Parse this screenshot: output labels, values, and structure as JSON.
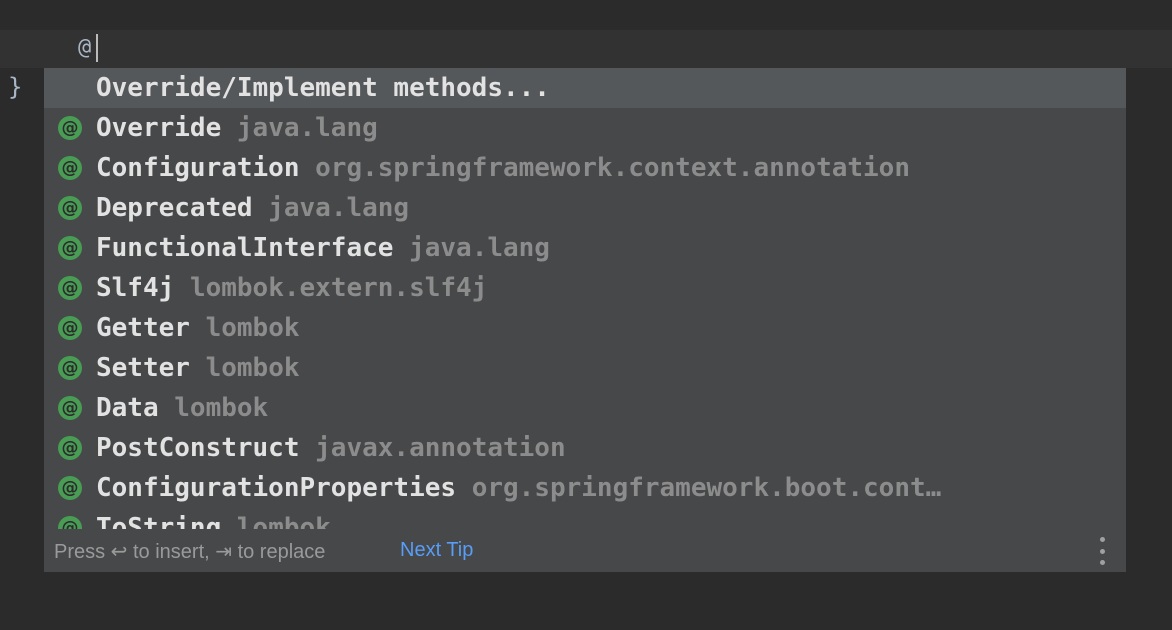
{
  "editor": {
    "typed_text": "@",
    "brace": "}"
  },
  "completion": {
    "items": [
      {
        "label": "Override/Implement methods...",
        "type": "action"
      },
      {
        "icon": "annotation-icon",
        "icon_glyph": "@",
        "name": "Override",
        "package": "java.lang"
      },
      {
        "icon": "annotation-icon",
        "icon_glyph": "@",
        "name": "Configuration",
        "package": "org.springframework.context.annotation"
      },
      {
        "icon": "annotation-icon",
        "icon_glyph": "@",
        "name": "Deprecated",
        "package": "java.lang"
      },
      {
        "icon": "annotation-icon",
        "icon_glyph": "@",
        "name": "FunctionalInterface",
        "package": "java.lang"
      },
      {
        "icon": "annotation-icon",
        "icon_glyph": "@",
        "name": "Slf4j",
        "package": "lombok.extern.slf4j"
      },
      {
        "icon": "annotation-icon",
        "icon_glyph": "@",
        "name": "Getter",
        "package": "lombok"
      },
      {
        "icon": "annotation-icon",
        "icon_glyph": "@",
        "name": "Setter",
        "package": "lombok"
      },
      {
        "icon": "annotation-icon",
        "icon_glyph": "@",
        "name": "Data",
        "package": "lombok"
      },
      {
        "icon": "annotation-icon",
        "icon_glyph": "@",
        "name": "PostConstruct",
        "package": "javax.annotation"
      },
      {
        "icon": "annotation-icon",
        "icon_glyph": "@",
        "name": "ConfigurationProperties",
        "package": "org.springframework.boot.cont…"
      },
      {
        "icon": "annotation-icon",
        "icon_glyph": "@",
        "name": "ToString",
        "package": "lombok"
      }
    ],
    "status": {
      "hint": "Press ↩ to insert, ⇥ to replace",
      "next_tip": "Next Tip",
      "more_icon": "more-vertical-icon"
    }
  },
  "colors": {
    "background": "#2b2b2b",
    "popup": "#46484a",
    "selected_row": "#55585a",
    "annotation_icon": "#499c54",
    "link": "#589df6"
  }
}
